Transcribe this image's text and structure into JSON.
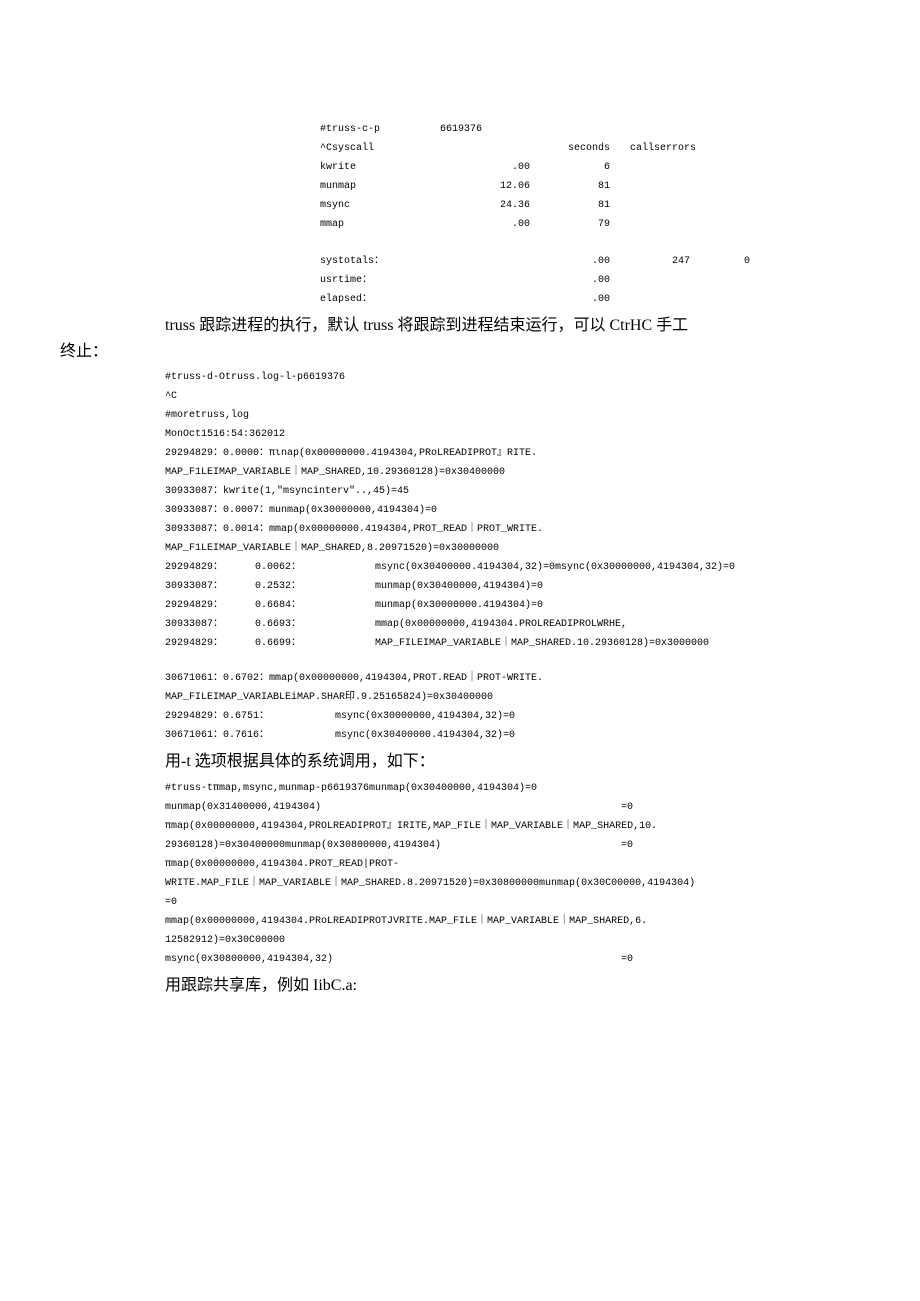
{
  "table": {
    "cmd": "#truss-c-p",
    "pid": "6619376",
    "h_syscall": "^Csyscall",
    "h_seconds": "seconds",
    "h_calls": "callserrors",
    "rows": [
      {
        "name": "kwrite",
        "sec": ".00",
        "calls": "6"
      },
      {
        "name": "munmap",
        "sec": "12.06",
        "calls": "81"
      },
      {
        "name": "msync",
        "sec": "24.36",
        "calls": "81"
      },
      {
        "name": "mmap",
        "sec": ".00",
        "calls": "79"
      }
    ],
    "totals": {
      "label": "systotals：",
      "sec": ".00",
      "calls": "247",
      "err": "0"
    },
    "usr": {
      "label": "usrtime：",
      "sec": ".00"
    },
    "elapsed": {
      "label": "elapsed：",
      "sec": ".00"
    }
  },
  "para1a": "truss 跟踪进程的执行，默认 truss 将跟踪到进程结束运行，可以 CtrHC 手工",
  "para1b": "终止：",
  "block1": {
    "l1": "#truss-d-Otruss.log-l-p6619376",
    "l2": "^C",
    "l3": "#moretruss,log",
    "l4": "MonOct1516:54:362012",
    "l5": "29294829：0.0000：πιnap(0x00000000.4194304,PRoLREADIPROT』RITE.",
    "l6": " MAP_F1LEIMAP_VARIABLE｜MAP_SHARED,10.29360128)=0x30400000",
    "l7": "30933087：kwrite(1,\"msyncinterv\"..,45)=45",
    "l8": "30933087：0.0007：munmap(0x30000000,4194304)=0",
    "l9": "30933087：0.0014：mmap(0x00000000.4194304,PROT_READ｜PROT_WRITE.",
    "l10": "MAP_F1LEIMAP_VARIABLE｜MAP_SHARED,8.20971520)=0x30000000",
    "r1": {
      "a": " 29294829：",
      "b": "0.0062：",
      "c": "msync(0x30400000.4194304,32)=0msync(0x30000000,4194304,32)=0"
    },
    "r2": {
      "a": " 30933087：",
      "b": "0.2532：",
      "c": "munmap(0x30400000,4194304)=0"
    },
    "r3": {
      "a": " 29294829：",
      "b": "0.6684：",
      "c": "munmap(0x30000000.4194304)=0"
    },
    "r4": {
      "a": " 30933087：",
      "b": "0.6693：",
      "c": "mmap(0x00000000,4194304.PROLREADIPROLWRHE,"
    },
    "r5": {
      "a": " 29294829：",
      "b": "0.6699：",
      "c": "MAP_FILEIMAP_VARIABLE｜MAP_SHARED.10.29360128)=0x3000000"
    },
    "l11": "30671061：0.6702：mmap(0x00000000,4194304,PROT.READ｜PROT-WRITE.",
    "l12": "MAP_FILEIMAP_VARIABLEiMAP.SHAR印.9.25165824)=0x30400000",
    "l13a": "29294829：0.6751：",
    "l13b": "msync(0x30000000,4194304,32)=0",
    "l14a": "30671061：0.7616：",
    "l14b": "msync(0x30400000.4194304,32)=0"
  },
  "para2": "用-t 选项根据具体的系统调用，如下：",
  "block2": {
    "l1": " #truss-tπmap,msync,munmap-p6619376munmap(0x30400000,4194304)=0",
    "l2a": " munmap(0x31400000,4194304)",
    "l2b": "=0",
    "l3": " πmap(0x00000000,4194304,PROLREADIPROT』IRITE,MAP_FILE｜MAP_VARIABLE｜MAP_SHARED,10.",
    "l4a": " 29360128)=0x30400000munmap(0x30800000,4194304)",
    "l4b": "=0",
    "l5": "  πmap(0x00000000,4194304.PROT_READ|PROT-",
    "l6a": "WRITE.MAP_FILE｜MAP_VARIABLE｜MAP_SHARED.8.20971520)=0x30800000munmap(0x30C00000,4194304)",
    "l6b": "=0",
    "l7": " mmap(0x00000000,4194304.PRoLREADIPROTJVRITE.MAP_FILE｜MAP_VARIABLE｜MAP_SHARED,6.",
    "l8": "12582912)=0x30C00000",
    "l9a": "msync(0x30800000,4194304,32)",
    "l9b": "=0"
  },
  "para3": "用跟踪共享库，例如 IibC.a:"
}
